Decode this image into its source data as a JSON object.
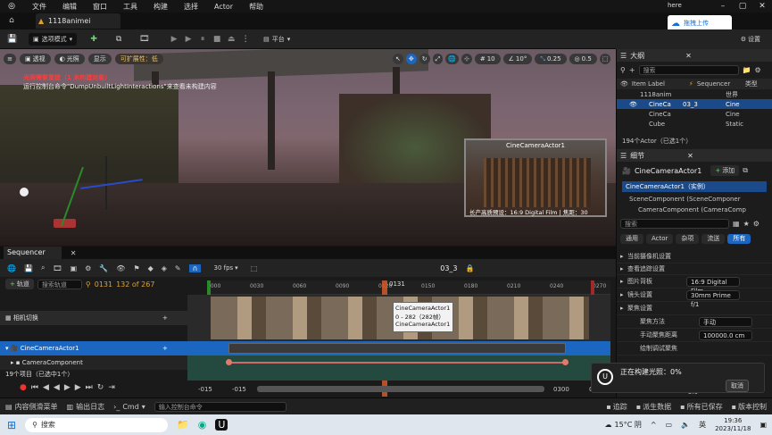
{
  "menubar": {
    "items": [
      "文件",
      "编辑",
      "窗口",
      "工具",
      "构建",
      "选择",
      "Actor",
      "帮助"
    ],
    "right_text": "here"
  },
  "tabs": {
    "project": "1118animei"
  },
  "upload_button": "拖拽上传",
  "toolbar": {
    "mode": "选项模式",
    "platform": "平台",
    "settings": "设置"
  },
  "viewport": {
    "perspective": "透视",
    "lit": "光照",
    "show": "显示",
    "scalability": "可扩展性：低",
    "warning_title": "光照需要重建（1 未构建对象）",
    "warning_msg": "运行控制台命令\"DumpUnbuiltLightInteractions\"来查看未构建内容",
    "grid": "10",
    "rot": "10°",
    "scale": "0.25",
    "speed": "0.5",
    "pip_title": "CineCameraActor1",
    "pip_caption": "长产高质预设：16:9 Digital Film | 焦距：30"
  },
  "outliner": {
    "title": "大纲",
    "search_placeholder": "搜索",
    "col_label": "Item Label",
    "col_seq": "Sequencer",
    "col_type": "类型",
    "rows": [
      {
        "label": "1118anim",
        "seq": "",
        "type": "世界"
      },
      {
        "label": "CineCa",
        "seq": "03_3",
        "type": "Cine"
      },
      {
        "label": "CineCa",
        "seq": "",
        "type": "Cine"
      },
      {
        "label": "Cube",
        "seq": "",
        "type": "Static"
      }
    ],
    "count": "194个Actor（已选1个）"
  },
  "details": {
    "title": "细节",
    "actor": "CineCameraActor1",
    "add": "添加",
    "instance": "CineCameraActor1（实例）",
    "components": [
      "SceneComponent (SceneComponer",
      "CameraComponent (CameraComp"
    ],
    "search_placeholder": "搜索",
    "filters": [
      "通用",
      "Actor",
      "杂项",
      "流送",
      "所有"
    ],
    "sections": [
      {
        "label": "当前摄像机设置",
        "value": ""
      },
      {
        "label": "查看追踪设置",
        "value": ""
      },
      {
        "label": "图片背板",
        "value": "16:9 Digital Film"
      },
      {
        "label": "镜头设置",
        "value": "30mm Prime f/1"
      },
      {
        "label": "聚焦设置",
        "value": ""
      },
      {
        "label": "聚焦方法",
        "value": "手动"
      },
      {
        "label": "手动聚焦距离",
        "value": "100000.0 cm"
      },
      {
        "label": "绘制调试聚焦",
        "value": ""
      }
    ],
    "trailing": "5.0"
  },
  "sequencer": {
    "title": "Sequencer",
    "fps": "30 fps",
    "name": "03_3",
    "add_track": "轨道",
    "search_placeholder": "搜索轨道",
    "frame": "0131",
    "range": "132 of 267",
    "ticks": [
      "0000",
      "0030",
      "0060",
      "0090",
      "0120",
      "0150",
      "0180",
      "0210",
      "0240",
      "0270"
    ],
    "playhead": "0131",
    "tracks": {
      "camera_cuts": "相机切换",
      "actor": "CineCameraActor1",
      "component": "CameraComponent"
    },
    "tooltip": [
      "CineCameraActor1",
      "0 - 282（282帧）",
      "CineCameraActor1"
    ],
    "items_count": "19个项目（已选中1个）",
    "bottom": [
      "-015",
      "-015",
      "0300",
      "0300"
    ]
  },
  "toast": {
    "msg": "正在构建光照：0%",
    "cancel": "取消"
  },
  "statusbar": {
    "drawer": "内容侧滑菜单",
    "log": "输出日志",
    "cmd": "Cmd",
    "console_placeholder": "输入控制台命令",
    "right": [
      "追踪",
      "派生数据",
      "所有已保存",
      "版本控制"
    ]
  },
  "taskbar": {
    "search": "搜索",
    "weather": "15°C 阴",
    "ime": "英",
    "time": "19:36",
    "date": "2023/11/18"
  }
}
